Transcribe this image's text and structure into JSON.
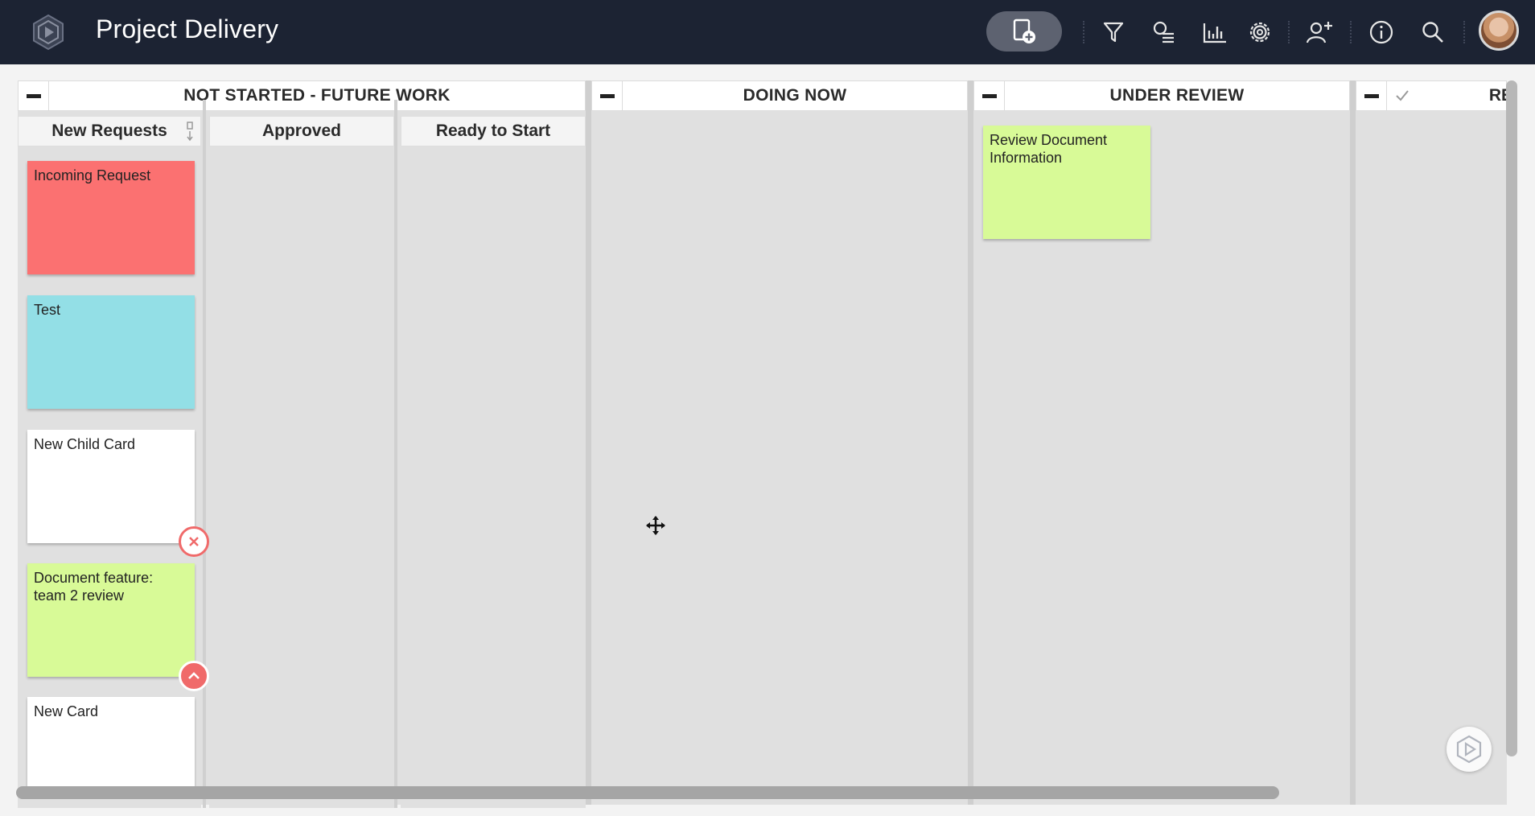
{
  "header": {
    "title": "Project Delivery"
  },
  "lanes": [
    {
      "title": "NOT STARTED - FUTURE WORK",
      "sublanes": [
        "New Requests",
        "Approved",
        "Ready to Start"
      ]
    },
    {
      "title": "DOING NOW"
    },
    {
      "title": "UNDER REVIEW"
    },
    {
      "title": "RE"
    }
  ],
  "cards": {
    "new_requests": [
      {
        "title": "Incoming Request",
        "color": "#fb7171"
      },
      {
        "title": "Test",
        "color": "#93dfe6"
      },
      {
        "title": "New Child Card",
        "color": "#ffffff"
      },
      {
        "title": "Document feature: team 2 review",
        "color": "#d8fa97"
      },
      {
        "title": "New Card",
        "color": "#ffffff"
      }
    ],
    "under_review": [
      {
        "title": "Review Document Information",
        "color": "#d8fa97"
      }
    ]
  },
  "icons": [
    "logo-icon",
    "add-card-icon",
    "filter-icon",
    "search-cards-icon",
    "analytics-icon",
    "settings-icon",
    "invite-user-icon",
    "info-icon",
    "search-icon",
    "user-avatar",
    "collapse-icon",
    "sort-icon",
    "remove-icon",
    "chevron-up-icon",
    "move-cursor-icon",
    "help-icon",
    "check-icon"
  ],
  "colors": {
    "topbar": "#1c2333",
    "lane_background": "#e0e0e0",
    "badge_red": "#f06a6a"
  }
}
